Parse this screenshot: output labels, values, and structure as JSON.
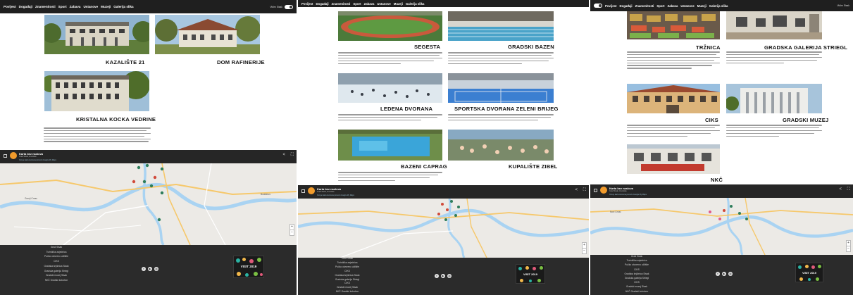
{
  "nav": {
    "items": [
      "Povijest",
      "Događaji",
      "Znamenitosti",
      "Sport",
      "Zabava",
      "Ustanove",
      "Muzeji",
      "Galerija slika"
    ],
    "vision_label": "Vidim Sisak"
  },
  "panel1": {
    "cards": [
      "KAZALIŠTE 21",
      "DOM RAFINERIJE",
      "KRISTALNA KOCKA VEDRINE"
    ],
    "description": "Dom kulture Kristalna kocka vedrine jedna je ustanova u kulturi Grada Siska, koji je osnovao Grad Sisak. Namijenjena je kulturno - društvenoj funkciji, za koncerte i programe raznih vrsta."
  },
  "panel2": {
    "cards": [
      "SEGESTA",
      "GRADSKI BAZEN",
      "LEDENA DVORANA",
      "SPORTSKA DVORANA ZELENI BRIJEG",
      "BAZENI CAPRAG",
      "KUPALIŠTE ZIBEL"
    ]
  },
  "panel3": {
    "cards": [
      "TRŽNICA",
      "GRADSKA GALERIJA STRIEGL",
      "CIKS",
      "GRADSKI MUZEJ",
      "NKČ"
    ]
  },
  "map": {
    "title": "Karta bez naslova",
    "subtitle": "Grad Sisak, Hrvatska",
    "note": "Ova je karta stvorena pomoću Google My Maps"
  },
  "footer": {
    "links_panel1": [
      "Grad Sisak",
      "Turistička zajednica",
      "Pučko otvoreno učilište",
      "CIKS",
      "Gradska knjižnica Sisak",
      "Gradska galerija Striegl",
      "Gradski muzej Sisak",
      "NKČ Gradski kolodvor"
    ],
    "links_panel2": [
      "Grad Sisak",
      "Turistička zajednica",
      "Pučko otvoreno učilište",
      "CIKS",
      "Gradska knjižnica Sisak",
      "Gradska galerija Striegl",
      "CIKS",
      "Gradski muzej Sisak",
      "NKČ Gradski kolodvor"
    ],
    "links_panel3": [
      "Grad Sisak",
      "Turistička zajednica",
      "Pučko otvoreno učilište",
      "CIKS",
      "Gradska knjižnica Sisak",
      "Gradska galerija Striegl",
      "CIKS",
      "Gradski muzej Sisak",
      "NKČ Gradski kolodvor"
    ],
    "badge_text": "VISIT 2019",
    "social_icons": [
      "facebook-icon",
      "youtube-icon",
      "instagram-icon"
    ]
  },
  "colors": {
    "nav_bg": "#1f1f1f",
    "footer_bg": "#2b2b2b",
    "map_water": "#a9d3f2",
    "map_road": "#f6c86b"
  }
}
